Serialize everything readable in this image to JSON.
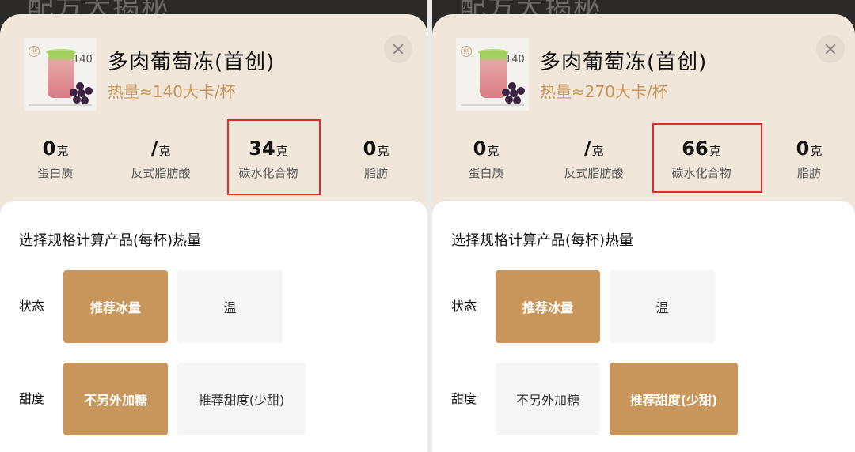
{
  "background_title": "配方大揭秘",
  "section_title": "选择规格计算产品(每杯)热量",
  "thumbnail_text": {
    "badge": "创",
    "number": "140"
  },
  "panels": [
    {
      "product_name": "多肉葡萄冻(首创)",
      "calories": "热量≈140大卡/杯",
      "nutrition": [
        {
          "value": "0",
          "unit": "克",
          "label": "蛋白质"
        },
        {
          "value": "/",
          "unit": "克",
          "label": "反式脂肪酸"
        },
        {
          "value": "34",
          "unit": "克",
          "label": "碳水化合物",
          "highlighted": true
        },
        {
          "value": "0",
          "unit": "克",
          "label": "脂肪"
        }
      ],
      "state_label": "状态",
      "state_options": [
        {
          "label": "推荐冰量",
          "selected": true
        },
        {
          "label": "温",
          "selected": false
        }
      ],
      "sweet_label": "甜度",
      "sweet_options": [
        {
          "label": "不另外加糖",
          "selected": true
        },
        {
          "label": "推荐甜度(少甜)",
          "selected": false
        }
      ]
    },
    {
      "product_name": "多肉葡萄冻(首创)",
      "calories": "热量≈270大卡/杯",
      "nutrition": [
        {
          "value": "0",
          "unit": "克",
          "label": "蛋白质"
        },
        {
          "value": "/",
          "unit": "克",
          "label": "反式脂肪酸"
        },
        {
          "value": "66",
          "unit": "克",
          "label": "碳水化合物",
          "highlighted": true
        },
        {
          "value": "0",
          "unit": "克",
          "label": "脂肪"
        }
      ],
      "state_label": "状态",
      "state_options": [
        {
          "label": "推荐冰量",
          "selected": true
        },
        {
          "label": "温",
          "selected": false
        }
      ],
      "sweet_label": "甜度",
      "sweet_options": [
        {
          "label": "不另外加糖",
          "selected": false
        },
        {
          "label": "推荐甜度(少甜)",
          "selected": true
        }
      ]
    }
  ],
  "colors": {
    "accent": "#c8965a",
    "sheet": "#f1e6da",
    "highlight_box": "#e32a2a"
  }
}
